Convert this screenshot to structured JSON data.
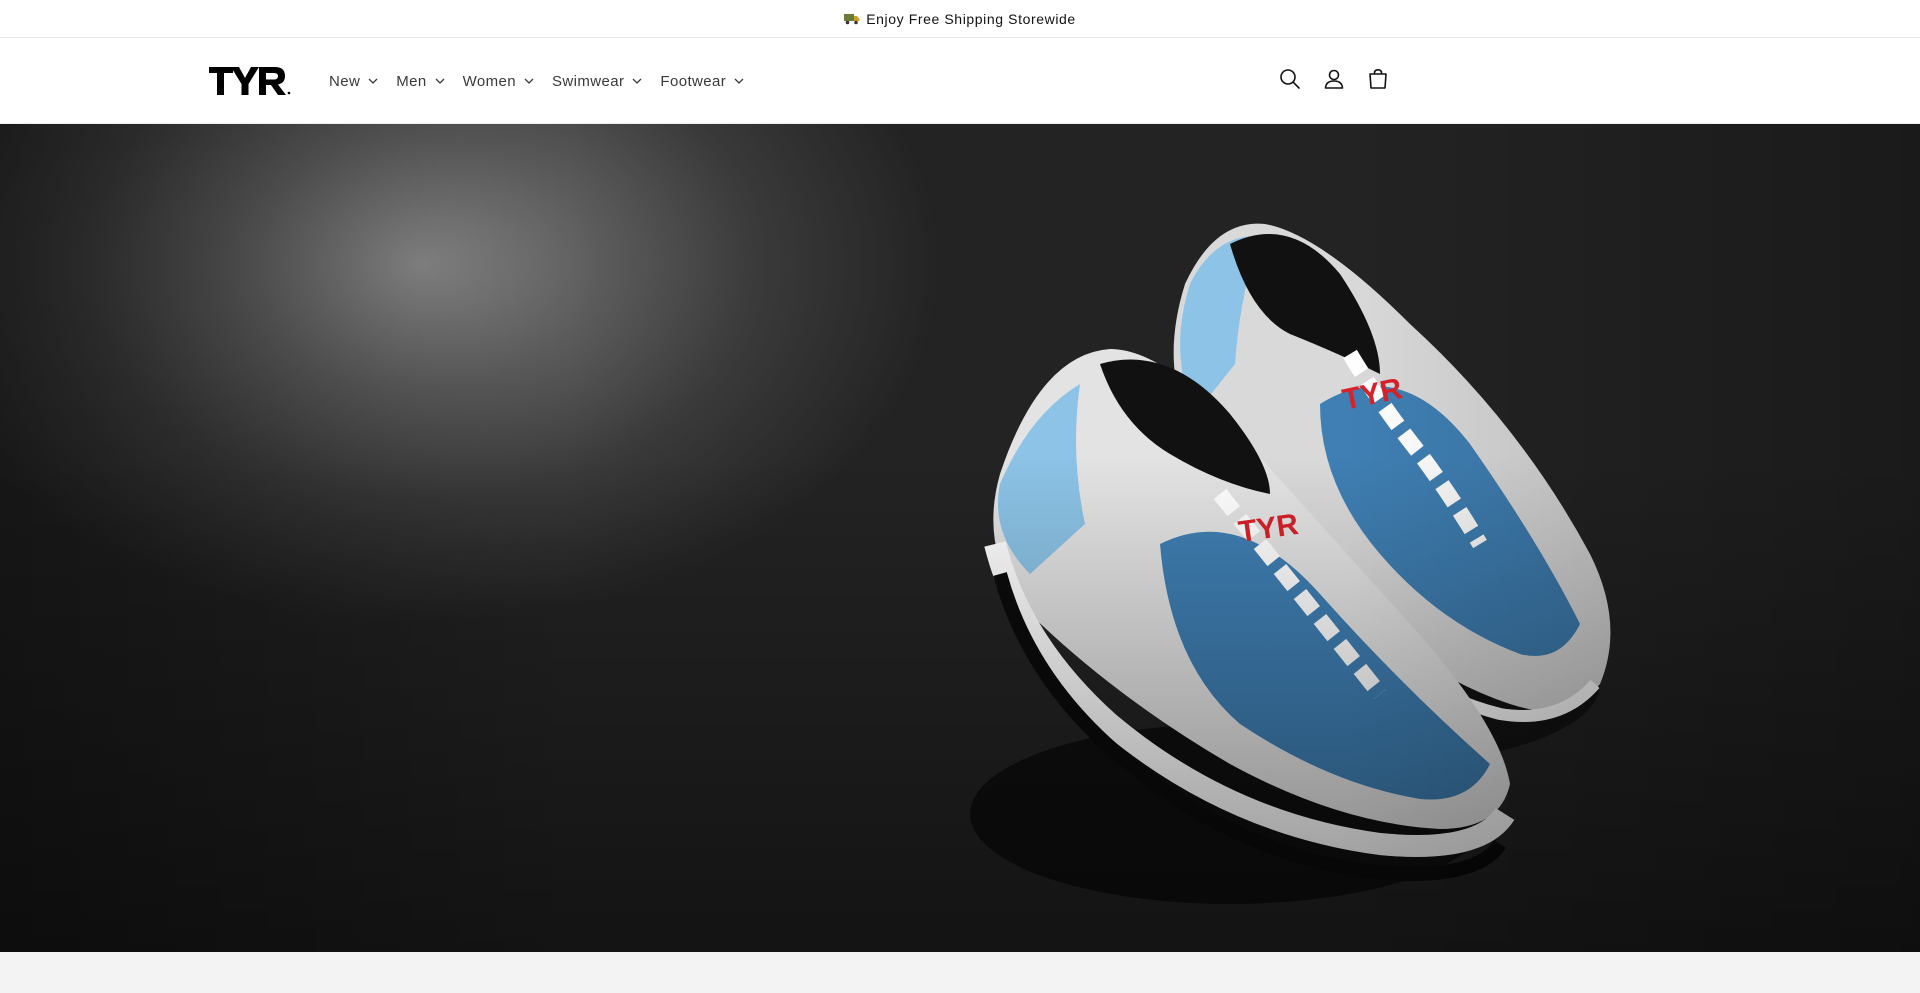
{
  "announcement": {
    "icon": "truck-icon",
    "text": "Enjoy Free Shipping Storewide"
  },
  "header": {
    "logo_text": "TYR",
    "nav": [
      {
        "label": "New",
        "icon": "chevron-down-icon"
      },
      {
        "label": "Men",
        "icon": "chevron-down-icon"
      },
      {
        "label": "Women",
        "icon": "chevron-down-icon"
      },
      {
        "label": "Swimwear",
        "icon": "chevron-down-icon"
      },
      {
        "label": "Footwear",
        "icon": "chevron-down-icon"
      }
    ],
    "actions": [
      "search-icon",
      "account-icon",
      "cart-icon"
    ]
  },
  "hero": {
    "image": "two-blue-white-tyr-sneakers-on-dark-slate",
    "shoe_brand_mark": "TYR"
  },
  "colors": {
    "text": "#121212",
    "nav_text": "#3a3a3a",
    "shoe_blue": "#3f7fb3",
    "shoe_light_blue": "#8cc3e6",
    "brand_red": "#d8222a"
  }
}
